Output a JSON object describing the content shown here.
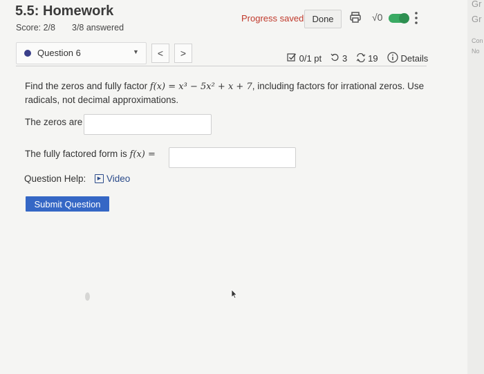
{
  "header": {
    "title": "5.5: Homework",
    "score": "Score: 2/8",
    "answered": "3/8 answered",
    "progress": "Progress saved",
    "done": "Done",
    "sqrt_label": "√0"
  },
  "sidebar": {
    "items": [
      "Gr",
      "Gr",
      "Con",
      "No"
    ]
  },
  "question_bar": {
    "question_label": "Question 6",
    "prev": "<",
    "next": ">",
    "points": "0/1 pt",
    "retries": "3",
    "attempts": "19",
    "details": "Details"
  },
  "question": {
    "text_before": "Find the zeros and fully factor ",
    "function": "f(x) = x³ − 5x² + x + 7",
    "text_after": ", including factors for irrational zeros. Use radicals, not decimal approximations.",
    "zeros_label": "The zeros are",
    "factored_label_before": "The fully factored form is ",
    "factored_math": "f(x) =",
    "help_label": "Question Help:",
    "video_label": "Video",
    "submit_label": "Submit Question"
  },
  "icons": [
    "print-icon",
    "checkbox-icon",
    "retry-icon",
    "attempts-icon",
    "info-icon",
    "more-vertical-icon",
    "dropdown-caret-icon",
    "video-icon",
    "cursor-icon"
  ],
  "colors": {
    "progress_text": "#c0392b",
    "submit_button": "#3567c5",
    "toggle": "#3aaa63",
    "question_dot": "#3a3f8a",
    "link": "#2a4a8a"
  }
}
